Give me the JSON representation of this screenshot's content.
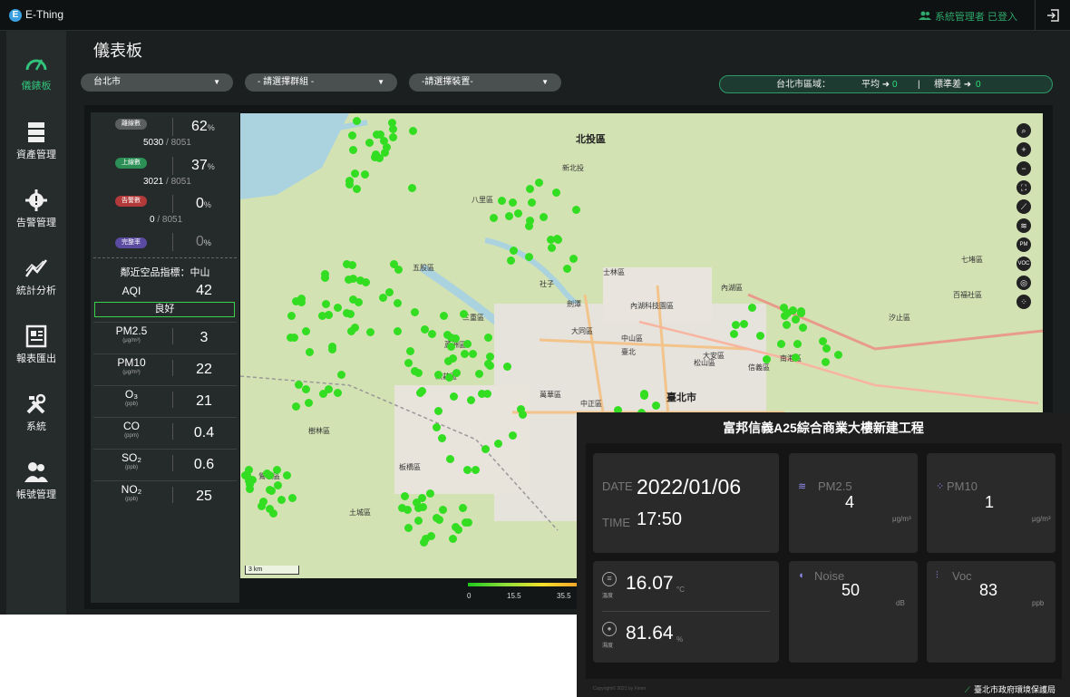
{
  "app": {
    "brand_letter": "E",
    "brand_name": "E-Thing",
    "login_status": "系統管理者 已登入",
    "logout_icon": "logout-icon"
  },
  "sidebar": {
    "items": [
      {
        "label": "儀錶板",
        "icon": "gauge-icon",
        "active": true
      },
      {
        "label": "資產管理",
        "icon": "server-icon"
      },
      {
        "label": "告警管理",
        "icon": "alert-icon"
      },
      {
        "label": "統計分析",
        "icon": "chart-line-icon"
      },
      {
        "label": "報表匯出",
        "icon": "report-icon"
      },
      {
        "label": "系統",
        "icon": "tools-icon"
      },
      {
        "label": "帳號管理",
        "icon": "users-icon"
      }
    ]
  },
  "page": {
    "title": "儀表板"
  },
  "filters": {
    "city": "台北市",
    "group": "- 請選擇群組 -",
    "device": "-請選擇裝置-"
  },
  "region_stats": {
    "label": "台北市區域：",
    "avg_label": "平均 ➜",
    "avg_value": "0",
    "sep": "|",
    "std_label": "標準差 ➜",
    "std_value": "0"
  },
  "device_stats": [
    {
      "badge": "離線數",
      "badge_color": "#5b5f5f",
      "percent": "62",
      "pct_unit": "%",
      "count": "5030",
      "total": "8051"
    },
    {
      "badge": "上線數",
      "badge_color": "#2c8f56",
      "percent": "37",
      "pct_unit": "%",
      "count": "3021",
      "total": "8051"
    },
    {
      "badge": "告警數",
      "badge_color": "#b23a3a",
      "percent": "0",
      "pct_unit": "%",
      "count": "0",
      "total": "8051"
    },
    {
      "badge": "完整率",
      "badge_color": "#5a4aa0",
      "percent": "0",
      "pct_unit": "%"
    }
  ],
  "air_quality": {
    "title": "鄰近空品指標：中山",
    "aqi_label": "AQI",
    "aqi_value": "42",
    "aqi_status": "良好",
    "pollutants": [
      {
        "name": "PM2.5",
        "unit": "(μg/m³)",
        "value": "3"
      },
      {
        "name": "PM10",
        "unit": "(μg/m³)",
        "value": "22"
      },
      {
        "name": "O₃",
        "unit": "(ppb)",
        "value": "21"
      },
      {
        "name": "CO",
        "unit": "(ppm)",
        "value": "0.4"
      },
      {
        "name": "SO₂",
        "unit": "(ppb)",
        "value": "0.6"
      },
      {
        "name": "NO₂",
        "unit": "(ppb)",
        "value": "25"
      }
    ]
  },
  "map": {
    "labels": [
      "北投區",
      "新北投",
      "士林區",
      "中山區",
      "大同區",
      "信義區",
      "大安區",
      "內湖區",
      "松山區",
      "南港區",
      "臺北市",
      "萬華區",
      "板橋區",
      "八里區",
      "五股區",
      "新莊區",
      "汐止區",
      "臺北",
      "三重區",
      "蘆洲區",
      "鶯歌區",
      "樹林區",
      "土城區",
      "中正區",
      "劍潭",
      "社子",
      "內湖科技園區",
      "七堵區",
      "百福社區"
    ],
    "scale": "3 km",
    "legend_ticks": [
      "0",
      "15.5",
      "35.5"
    ],
    "controls": [
      "search-icon",
      "zoom-in-icon",
      "zoom-out-icon",
      "fullscreen-icon",
      "ruler-icon",
      "wind-icon",
      "PM 2.5",
      "VOC",
      "target-icon",
      "dots-icon"
    ]
  },
  "site": {
    "title": "富邦信義A25綜合商業大樓新建工程",
    "date_label": "DATE",
    "date_value": "2022/01/06",
    "time_label": "TIME",
    "time_value": "17:50",
    "pm25_label": "PM2.5",
    "pm25_value": "4",
    "pm25_unit": "μg/m³",
    "pm10_label": "PM10",
    "pm10_value": "1",
    "pm10_unit": "μg/m³",
    "temp_value": "16.07",
    "temp_unit": "°C",
    "temp_label": "溫度",
    "hum_value": "81.64",
    "hum_unit": "%",
    "hum_label": "濕度",
    "noise_label": "Noise",
    "noise_value": "50",
    "noise_unit": "dB",
    "voc_label": "Voc",
    "voc_value": "83",
    "voc_unit": "ppb",
    "copyright": "Copyright© 2021 by Fimer",
    "org": "臺北市政府環境保護局"
  }
}
